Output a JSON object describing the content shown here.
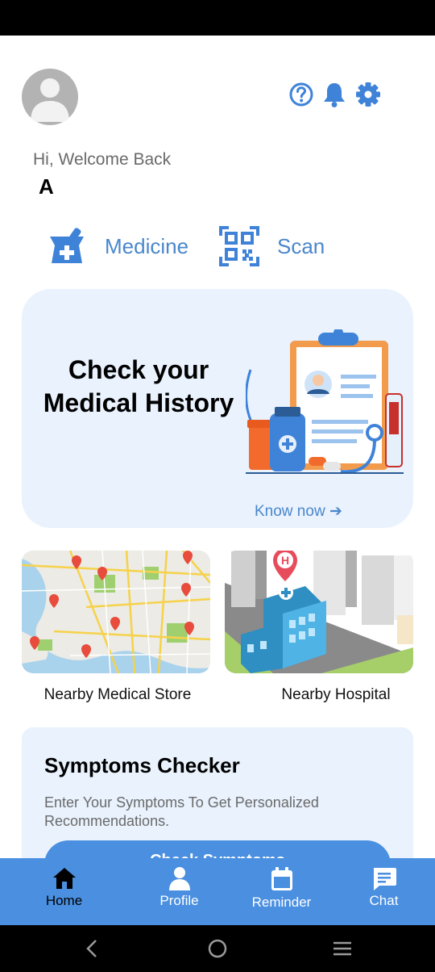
{
  "header": {
    "help_icon": "help-circle-icon",
    "notification_icon": "bell-icon",
    "settings_icon": "gear-icon",
    "greeting": "Hi, Welcome Back",
    "username": "A"
  },
  "quick_actions": [
    {
      "label": "Medicine",
      "icon": "medicine-icon"
    },
    {
      "label": "Scan",
      "icon": "qr-scan-icon"
    }
  ],
  "history_card": {
    "title_line1": "Check your",
    "title_line2": "Medical  History",
    "link": "Know now ➔"
  },
  "tiles": [
    {
      "caption": "Nearby Medical Store",
      "image": "city-map-illustration"
    },
    {
      "caption": "Nearby Hospital",
      "image": "hospital-illustration"
    }
  ],
  "symptoms": {
    "title": "Symptoms Checker",
    "description": "Enter Your Symptoms To Get Personalized Recommendations.",
    "button": "Check Symptoms"
  },
  "bottom_nav": [
    {
      "label": "Home",
      "icon": "home-icon",
      "active": true
    },
    {
      "label": "Profile",
      "icon": "person-icon",
      "active": false
    },
    {
      "label": "Reminder",
      "icon": "calendar-icon",
      "active": false
    },
    {
      "label": "Chat",
      "icon": "chat-icon",
      "active": false
    }
  ],
  "colors": {
    "accent": "#4a87cc",
    "nav_background": "#4a8fe0",
    "card_background": "#e9f2fd"
  }
}
